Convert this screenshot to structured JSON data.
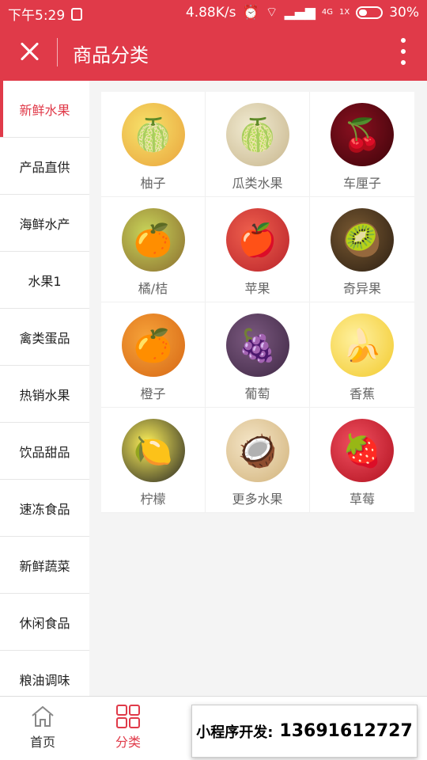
{
  "status_bar": {
    "time": "下午5:29",
    "network_speed": "4.88K/s",
    "network_type": "4G",
    "sim_label": "1X",
    "battery": "30%"
  },
  "header": {
    "title": "商品分类"
  },
  "sidebar": {
    "active_index": 0,
    "items": [
      {
        "label": "新鲜水果"
      },
      {
        "label": "产品直供"
      },
      {
        "label": "海鲜水产"
      },
      {
        "label": "水果1"
      },
      {
        "label": "禽类蛋品"
      },
      {
        "label": "热销水果"
      },
      {
        "label": "饮品甜品"
      },
      {
        "label": "速冻食品"
      },
      {
        "label": "新鲜蔬菜"
      },
      {
        "label": "休闲食品"
      },
      {
        "label": "粮油调味"
      }
    ]
  },
  "grid": {
    "items": [
      {
        "label": "柚子",
        "icon": "pomelo-icon"
      },
      {
        "label": "瓜类水果",
        "icon": "melon-icon"
      },
      {
        "label": "车厘子",
        "icon": "cherry-icon"
      },
      {
        "label": "橘/桔",
        "icon": "tangerine-icon"
      },
      {
        "label": "苹果",
        "icon": "apple-icon"
      },
      {
        "label": "奇异果",
        "icon": "kiwi-icon"
      },
      {
        "label": "橙子",
        "icon": "orange-icon"
      },
      {
        "label": "葡萄",
        "icon": "grape-icon"
      },
      {
        "label": "香蕉",
        "icon": "banana-icon"
      },
      {
        "label": "柠檬",
        "icon": "lemon-icon"
      },
      {
        "label": "更多水果",
        "icon": "longan-icon"
      },
      {
        "label": "草莓",
        "icon": "strawberry-icon"
      }
    ]
  },
  "bottom_nav": {
    "home_label": "首页",
    "category_label": "分类",
    "promo_text": "小程序开发:",
    "promo_phone": "13691612727"
  },
  "colors": {
    "accent": "#e03a49",
    "sidebar_bg": "#ffffff",
    "page_bg": "#f4f4f4"
  }
}
